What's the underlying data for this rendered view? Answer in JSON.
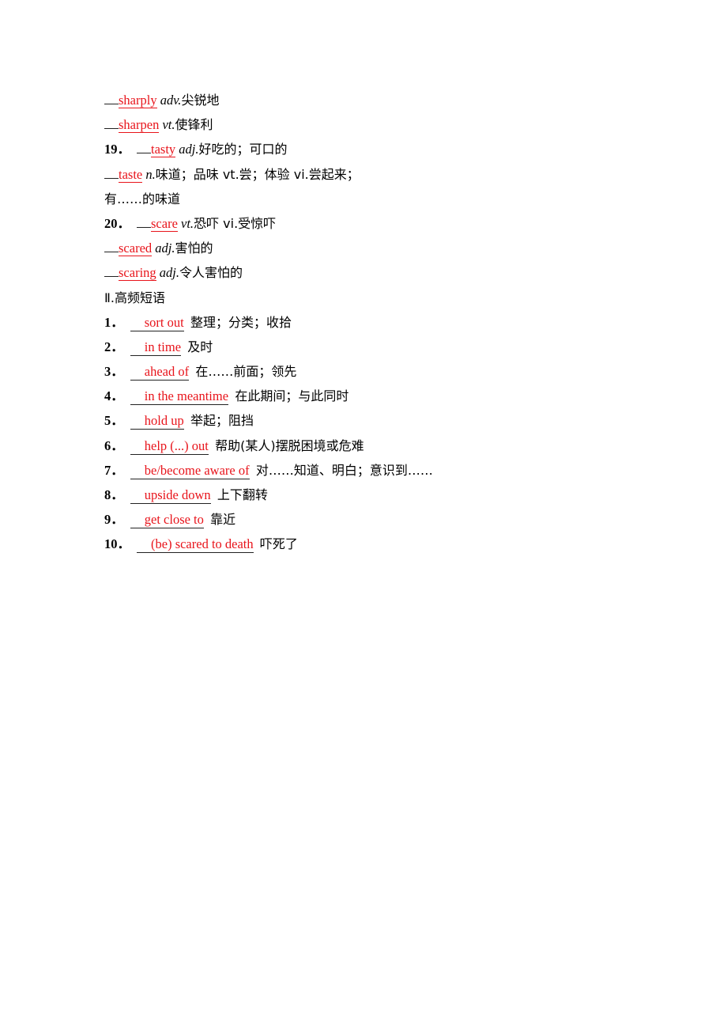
{
  "words": [
    {
      "num": "",
      "answer": "sharply",
      "pos": "adv.",
      "meaning": "尖锐地"
    },
    {
      "num": "",
      "answer": "sharpen",
      "pos": "vt.",
      "meaning": "使锋利"
    },
    {
      "num": "19．",
      "answer": "tasty",
      "pos": "adj.",
      "meaning": "好吃的；可口的"
    },
    {
      "num": "",
      "answer": "taste",
      "pos": "n.",
      "meaning": "味道；品味 vt.尝；体验 vi.尝起来；"
    },
    {
      "num": "",
      "answer": "",
      "pos": "",
      "meaning": "有……的味道"
    },
    {
      "num": "20．",
      "answer": "scare",
      "pos": "vt.",
      "meaning": "恐吓 vi.受惊吓"
    },
    {
      "num": "",
      "answer": "scared",
      "pos": "adj.",
      "meaning": "害怕的"
    },
    {
      "num": "",
      "answer": "scaring",
      "pos": "adj.",
      "meaning": "令人害怕的"
    }
  ],
  "section_title": "Ⅱ.高频短语",
  "phrases": [
    {
      "num": "1．",
      "answer": "sort out",
      "meaning": "整理；分类；收拾"
    },
    {
      "num": "2．",
      "answer": "in time",
      "meaning": "及时"
    },
    {
      "num": "3．",
      "answer": "ahead of",
      "meaning": "在……前面；领先"
    },
    {
      "num": "4．",
      "answer": "in the meantime",
      "meaning": "在此期间；与此同时"
    },
    {
      "num": "5．",
      "answer": "hold up",
      "meaning": "举起；阻挡"
    },
    {
      "num": "6．",
      "answer": "help (...) out",
      "meaning": "帮助(某人)摆脱困境或危难"
    },
    {
      "num": "7．",
      "answer": "be/become aware of",
      "meaning": "对……知道、明白；意识到……"
    },
    {
      "num": "8．",
      "answer": "upside down",
      "meaning": "上下翻转"
    },
    {
      "num": "9．",
      "answer": "get close to",
      "meaning": "靠近"
    },
    {
      "num": "10．",
      "answer": "(be) scared to death",
      "meaning": "吓死了"
    }
  ],
  "colors": {
    "answer": "#e8141b",
    "text": "#000000"
  }
}
